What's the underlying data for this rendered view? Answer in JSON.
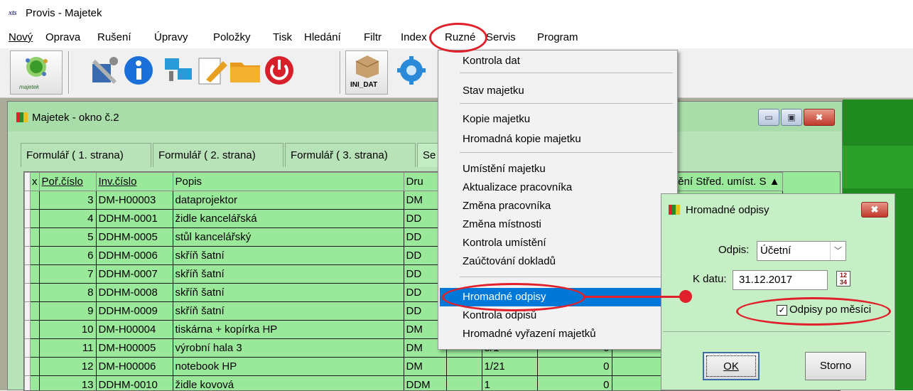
{
  "app": {
    "title": "Provis - Majetek",
    "icon_text": "xts"
  },
  "menubar": [
    "Nový",
    "Oprava",
    "Rušení",
    "Úpravy",
    "Položky",
    "Tisk",
    "Hledání",
    "Filtr",
    "Index",
    "Ruzné",
    "Servis",
    "Program"
  ],
  "toolbar": {
    "logo_label": "majetek",
    "ini_label": "INI_DAT",
    "icons": [
      "majetek-logo-icon",
      "tools-icon",
      "info-icon",
      "network-icon",
      "edit-icon",
      "folder-icon",
      "power-icon",
      "package-icon",
      "gear-icon"
    ]
  },
  "window": {
    "title": "Majetek - okno č.2",
    "caption_buttons": {
      "minimize": "▭",
      "maximize": "▣",
      "close": "✖"
    },
    "tabs": [
      "Formulář ( 1. strana)",
      "Formulář ( 2. strana)",
      "Formulář ( 3. strana)",
      "Se"
    ],
    "columns": [
      "x",
      "Poř.číslo",
      "Inv.číslo",
      "Popis",
      "Dru"
    ],
    "right_columns": "ístění Střed. umíst.  S",
    "rows": [
      {
        "por": "3",
        "inv": "DM-H00003",
        "popis": "dataprojektor",
        "druh": "DM"
      },
      {
        "por": "4",
        "inv": "DDHM-0001",
        "popis": "židle kancelářská",
        "druh": "DD"
      },
      {
        "por": "5",
        "inv": "DDHM-0005",
        "popis": "stůl kancelářský",
        "druh": "DD"
      },
      {
        "por": "6",
        "inv": "DDHM-0006",
        "popis": "skříň šatní",
        "druh": "DD"
      },
      {
        "por": "7",
        "inv": "DDHM-0007",
        "popis": "skříň šatní",
        "druh": "DD"
      },
      {
        "por": "8",
        "inv": "DDHM-0008",
        "popis": "skříň šatní",
        "druh": "DD"
      },
      {
        "por": "9",
        "inv": "DDHM-0009",
        "popis": "skříň šatní",
        "druh": "DD"
      },
      {
        "por": "10",
        "inv": "DM-H00004",
        "popis": "tiskárna + kopírka HP",
        "druh": "DM"
      },
      {
        "por": "11",
        "inv": "DM-H00005",
        "popis": "výrobní hala 3",
        "druh": "DM",
        "loc": "5/1",
        "val": "0"
      },
      {
        "por": "12",
        "inv": "DM-H00006",
        "popis": "notebook HP",
        "druh": "DM",
        "loc": "1/21",
        "val": "0"
      },
      {
        "por": "13",
        "inv": "DDHM-0010",
        "popis": "židle kovová",
        "druh": "DDM",
        "loc": "1",
        "val": "0"
      }
    ]
  },
  "context_menu": {
    "items": [
      "Kontrola dat",
      "Stav majetku",
      "Kopie majetku",
      "Hromadná kopie majetku",
      "Umístění majetku",
      "Aktualizace pracovníka",
      "Změna pracovníka",
      "Změna místnosti",
      "Kontrola umístění",
      "Zaúčtování dokladů",
      "Hromadné odpisy",
      "Kontrola odpisů",
      "Hromadné vyřazení majetků"
    ],
    "selected": "Hromadné odpisy"
  },
  "dialog": {
    "title": "Hromadné odpisy",
    "close": "✖",
    "odpis_label": "Odpis:",
    "odpis_value": "Účetní",
    "dropdown_arrow": "﹀",
    "kdatu_label": "K datu:",
    "kdatu_value": "31.12.2017",
    "calendar_glyph": "12\n34",
    "checkbox_mark": "✓",
    "checkbox_label": "Odpisy po měsíci",
    "checkbox_checked": true,
    "ok": "OK",
    "storno": "Storno"
  },
  "colors": {
    "highlight": "#0078d7",
    "grid_green": "#9ae89a",
    "annotation_red": "#e0202a"
  }
}
